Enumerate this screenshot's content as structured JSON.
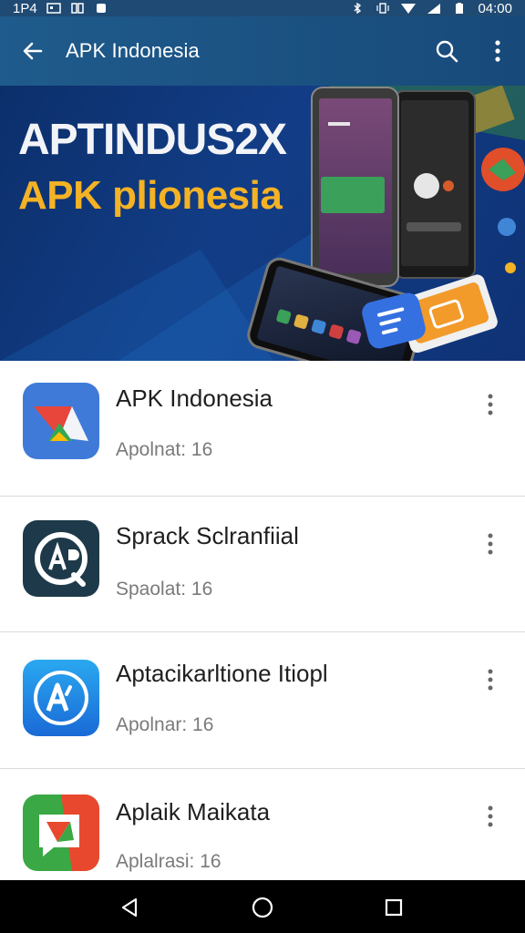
{
  "status_bar": {
    "left_text": "1P4",
    "time": "04:00"
  },
  "app_bar": {
    "title": "APK Indonesia"
  },
  "banner": {
    "headline": "APTINDUS2X",
    "subheadline": "APK plionesia"
  },
  "apps": [
    {
      "name": "APK Indonesia",
      "meta": "Apolnat: 16"
    },
    {
      "name": "Sprack Sclranfiial",
      "meta": "Spaolat: 16"
    },
    {
      "name": "Aptacikarltione Itiopl",
      "meta": "Apolnar: 16"
    },
    {
      "name": "Aplaik Maikata",
      "meta": "Aplalrasi: 16"
    }
  ],
  "colors": {
    "app_bar": "#1f5b8c",
    "banner_bg": "#0f3275",
    "banner_accent": "#f4b225"
  }
}
